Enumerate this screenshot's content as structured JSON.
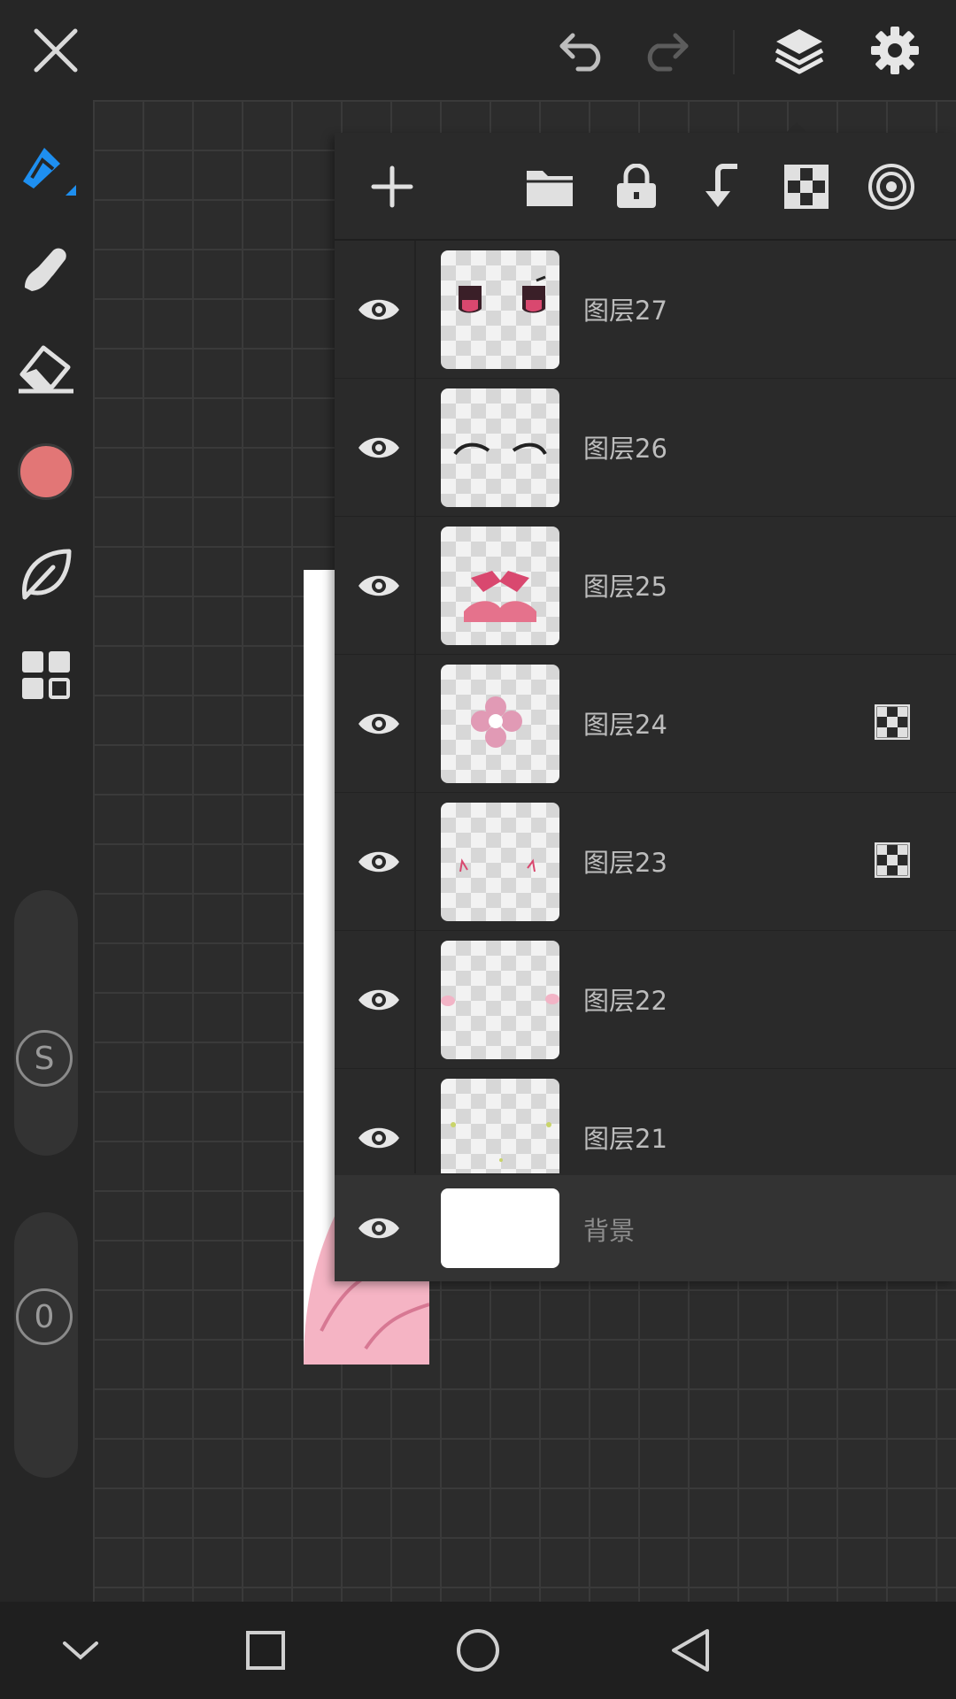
{
  "colors": {
    "accent": "#1e8ff0",
    "current_color": "#e27676",
    "panel_bg": "#2a2a2a"
  },
  "topbar": {
    "icons": [
      "close-icon",
      "undo-icon",
      "redo-icon",
      "layers-icon",
      "settings-icon"
    ]
  },
  "left_toolbar": {
    "tools": [
      "pen-icon",
      "smudge-icon",
      "eraser-icon",
      "color-swatch",
      "leaf-brush-icon",
      "grid-icon"
    ],
    "size_pill_label": "S",
    "opacity_pill_label": "0"
  },
  "layers_panel": {
    "header_icons": [
      "add-icon",
      "folder-icon",
      "lock-icon",
      "merge-down-icon",
      "transparency-icon",
      "target-icon"
    ],
    "layers": [
      {
        "name": "图层27",
        "badge": false
      },
      {
        "name": "图层26",
        "badge": false
      },
      {
        "name": "图层25",
        "badge": false
      },
      {
        "name": "图层24",
        "badge": true
      },
      {
        "name": "图层23",
        "badge": true
      },
      {
        "name": "图层22",
        "badge": false
      },
      {
        "name": "图层21",
        "badge": false
      }
    ],
    "background_layer": "背景"
  },
  "navbar": {
    "icons": [
      "collapse-icon",
      "recents-icon",
      "home-icon",
      "back-icon"
    ]
  }
}
